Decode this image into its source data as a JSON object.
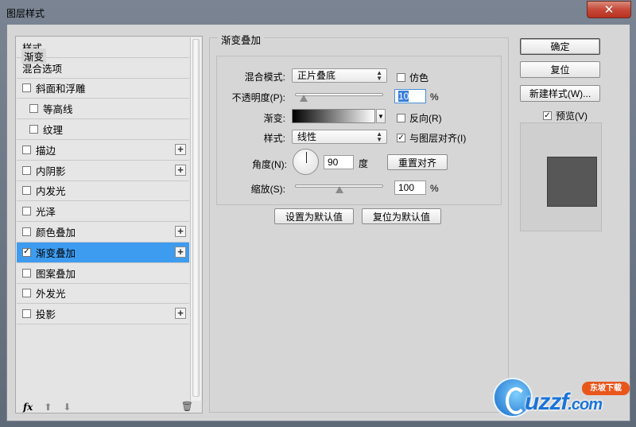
{
  "window": {
    "title": "图层样式",
    "close_glyph": "✕"
  },
  "sidebar": {
    "items": [
      {
        "label": "样式",
        "checkbox": false,
        "checked": false,
        "plus": false,
        "indent": false,
        "selected": false
      },
      {
        "label": "混合选项",
        "checkbox": false,
        "checked": false,
        "plus": false,
        "indent": false,
        "selected": false
      },
      {
        "label": "斜面和浮雕",
        "checkbox": true,
        "checked": false,
        "plus": false,
        "indent": false,
        "selected": false
      },
      {
        "label": "等高线",
        "checkbox": true,
        "checked": false,
        "plus": false,
        "indent": true,
        "selected": false
      },
      {
        "label": "纹理",
        "checkbox": true,
        "checked": false,
        "plus": false,
        "indent": true,
        "selected": false
      },
      {
        "label": "描边",
        "checkbox": true,
        "checked": false,
        "plus": true,
        "indent": false,
        "selected": false
      },
      {
        "label": "内阴影",
        "checkbox": true,
        "checked": false,
        "plus": true,
        "indent": false,
        "selected": false
      },
      {
        "label": "内发光",
        "checkbox": true,
        "checked": false,
        "plus": false,
        "indent": false,
        "selected": false
      },
      {
        "label": "光泽",
        "checkbox": true,
        "checked": false,
        "plus": false,
        "indent": false,
        "selected": false
      },
      {
        "label": "颜色叠加",
        "checkbox": true,
        "checked": false,
        "plus": true,
        "indent": false,
        "selected": false
      },
      {
        "label": "渐变叠加",
        "checkbox": true,
        "checked": true,
        "plus": true,
        "indent": false,
        "selected": true
      },
      {
        "label": "图案叠加",
        "checkbox": true,
        "checked": false,
        "plus": false,
        "indent": false,
        "selected": false
      },
      {
        "label": "外发光",
        "checkbox": true,
        "checked": false,
        "plus": false,
        "indent": false,
        "selected": false
      },
      {
        "label": "投影",
        "checkbox": true,
        "checked": false,
        "plus": true,
        "indent": false,
        "selected": false
      }
    ],
    "footer": {
      "fx_label": "fx",
      "up_arrow": "⬆",
      "down_arrow": "⬇",
      "trash_glyph": "🗑"
    }
  },
  "gradient_overlay": {
    "group_title": "渐变叠加",
    "subgroup_title": "渐变",
    "blend_mode_label": "混合模式:",
    "blend_mode_value": "正片叠底",
    "dither_label": "仿色",
    "opacity_label": "不透明度(P):",
    "opacity_value": "10",
    "opacity_level": 0.1,
    "percent": "%",
    "gradient_label": "渐变:",
    "reverse_label": "反向(R)",
    "style_label": "样式:",
    "style_value": "线性",
    "align_label": "与图层对齐(I)",
    "angle_label": "角度(N):",
    "angle_value": "90",
    "degree_unit": "度",
    "reset_align_label": "重置对齐",
    "scale_label": "缩放(S):",
    "scale_value": "100",
    "scale_level": 0.5,
    "make_default_label": "设置为默认值",
    "reset_default_label": "复位为默认值"
  },
  "actions": {
    "ok_label": "确定",
    "reset_label": "复位",
    "new_style_label": "新建样式(W)...",
    "preview_label": "预览(V)",
    "preview_checked": true,
    "preview_color": "#575757"
  },
  "watermark": {
    "badge": "东坡下载",
    "brand": "uzzf",
    "suffix": ".com"
  }
}
